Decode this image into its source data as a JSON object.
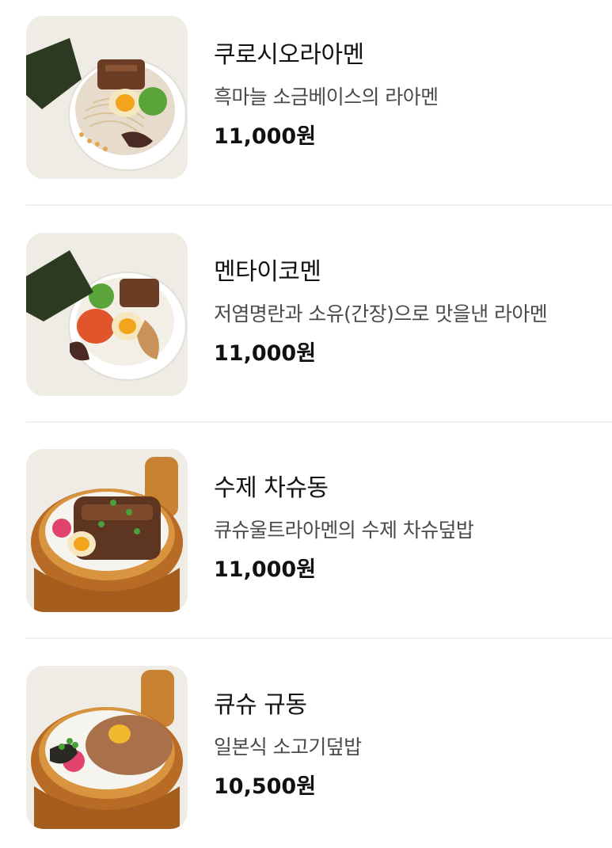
{
  "menu": {
    "items": [
      {
        "name": "쿠로시오라아멘",
        "description": "흑마늘 소금베이스의 라아멘",
        "price": "11,000원",
        "image_icon": "ramen-bowl-image"
      },
      {
        "name": "멘타이코멘",
        "description": "저염명란과 소유(간장)으로 맛을낸 라아멘",
        "price": "11,000원",
        "image_icon": "ramen-bowl-image"
      },
      {
        "name": "수제 차슈동",
        "description": "큐슈울트라아멘의 수제 차슈덮밥",
        "price": "11,000원",
        "image_icon": "rice-tub-image"
      },
      {
        "name": "큐슈 규동",
        "description": "일본식 소고기덮밥",
        "price": "10,500원",
        "image_icon": "rice-tub-image"
      }
    ]
  },
  "colors": {
    "text_primary": "#121212",
    "text_secondary": "#4a4a4a",
    "divider": "#f0f0f0",
    "image_background": "#f1efe9"
  }
}
